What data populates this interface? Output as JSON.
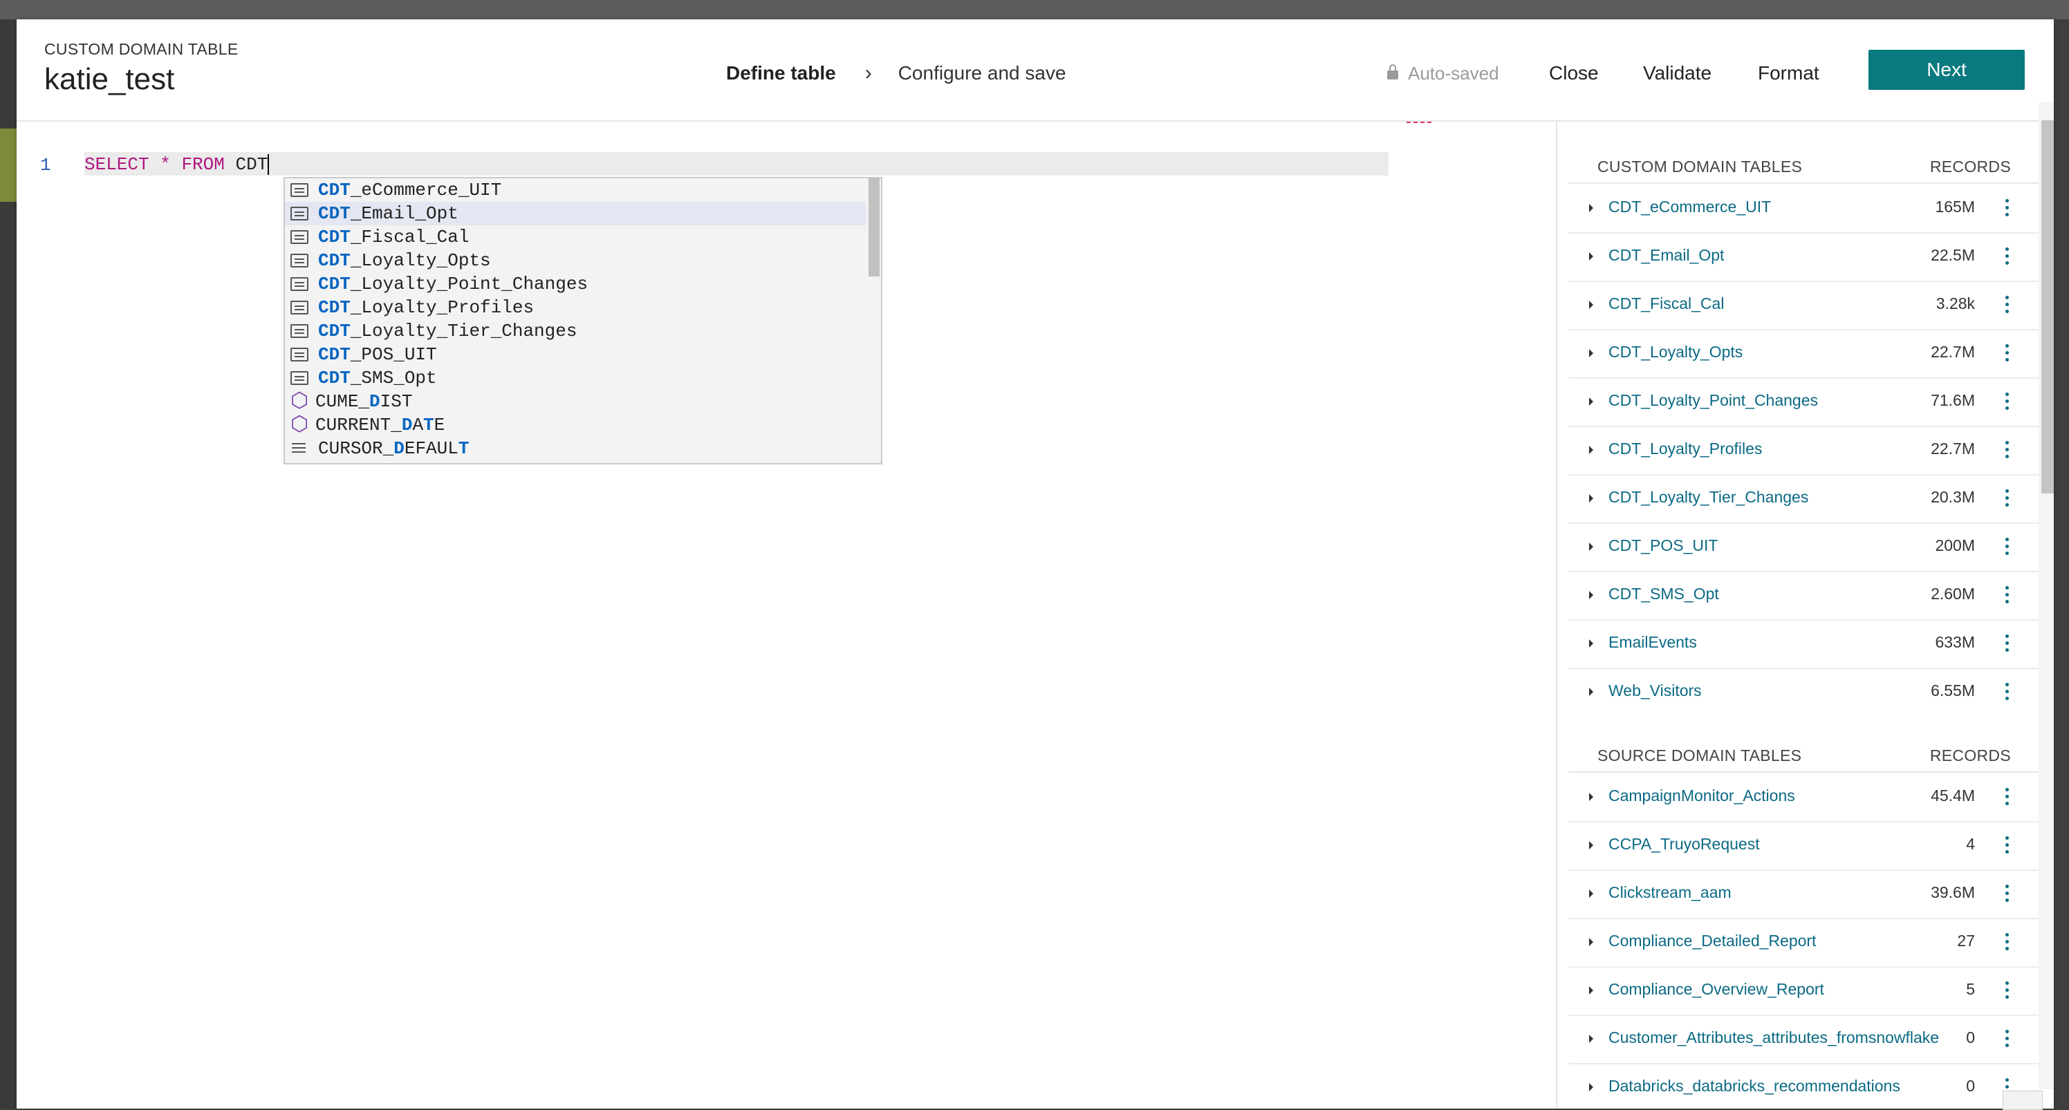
{
  "header": {
    "eyebrow": "CUSTOM DOMAIN TABLE",
    "title": "katie_test",
    "steps": [
      {
        "label": "Define table",
        "active": true
      },
      {
        "label": "Configure and save",
        "active": false
      }
    ],
    "autosaved": "Auto-saved",
    "close_label": "Close",
    "validate_label": "Validate",
    "format_label": "Format",
    "next_label": "Next"
  },
  "editor": {
    "line_number": "1",
    "code_keyword1": "SELECT",
    "code_star": "*",
    "code_keyword2": "FROM",
    "code_typed": "CDT"
  },
  "suggestions": [
    {
      "icon": "table-icon",
      "match": "CDT",
      "rest": "_eCommerce_UIT"
    },
    {
      "icon": "table-icon",
      "match": "CDT",
      "rest": "_Email_Opt"
    },
    {
      "icon": "table-icon",
      "match": "CDT",
      "rest": "_Fiscal_Cal"
    },
    {
      "icon": "table-icon",
      "match": "CDT",
      "rest": "_Loyalty_Opts"
    },
    {
      "icon": "table-icon",
      "match": "CDT",
      "rest": "_Loyalty_Point_Changes"
    },
    {
      "icon": "table-icon",
      "match": "CDT",
      "rest": "_Loyalty_Profiles"
    },
    {
      "icon": "table-icon",
      "match": "CDT",
      "rest": "_Loyalty_Tier_Changes"
    },
    {
      "icon": "table-icon",
      "match": "CDT",
      "rest": "_POS_UIT"
    },
    {
      "icon": "table-icon",
      "match": "CDT",
      "rest": "_SMS_Opt"
    },
    {
      "icon": "function-icon",
      "parts": [
        "C",
        "UME_",
        "D",
        "IST"
      ]
    },
    {
      "icon": "function-icon",
      "parts": [
        "C",
        "URRENT_",
        "D",
        "A",
        "T",
        "E"
      ]
    },
    {
      "icon": "keyword-icon",
      "parts": [
        "C",
        "URSOR_",
        "D",
        "EFAUL",
        "T"
      ]
    }
  ],
  "panel": {
    "custom": {
      "title": "CUSTOM DOMAIN TABLES",
      "records_label": "RECORDS",
      "rows": [
        {
          "name": "CDT_eCommerce_UIT",
          "records": "165M"
        },
        {
          "name": "CDT_Email_Opt",
          "records": "22.5M"
        },
        {
          "name": "CDT_Fiscal_Cal",
          "records": "3.28k"
        },
        {
          "name": "CDT_Loyalty_Opts",
          "records": "22.7M"
        },
        {
          "name": "CDT_Loyalty_Point_Changes",
          "records": "71.6M"
        },
        {
          "name": "CDT_Loyalty_Profiles",
          "records": "22.7M"
        },
        {
          "name": "CDT_Loyalty_Tier_Changes",
          "records": "20.3M"
        },
        {
          "name": "CDT_POS_UIT",
          "records": "200M"
        },
        {
          "name": "CDT_SMS_Opt",
          "records": "2.60M"
        },
        {
          "name": "EmailEvents",
          "records": "633M"
        },
        {
          "name": "Web_Visitors",
          "records": "6.55M"
        }
      ]
    },
    "source": {
      "title": "SOURCE DOMAIN TABLES",
      "records_label": "RECORDS",
      "rows": [
        {
          "name": "CampaignMonitor_Actions",
          "records": "45.4M"
        },
        {
          "name": "CCPA_TruyoRequest",
          "records": "4"
        },
        {
          "name": "Clickstream_aam",
          "records": "39.6M"
        },
        {
          "name": "Compliance_Detailed_Report",
          "records": "27"
        },
        {
          "name": "Compliance_Overview_Report",
          "records": "5"
        },
        {
          "name": "Customer_Attributes_attributes_fromsnowflake",
          "records": "0"
        },
        {
          "name": "Databricks_databricks_recommendations",
          "records": "0"
        }
      ]
    }
  },
  "colors": {
    "accent": "#0b7a80",
    "link": "#0b6a84",
    "keyword": "#b0177e",
    "match": "#0a66c2"
  }
}
